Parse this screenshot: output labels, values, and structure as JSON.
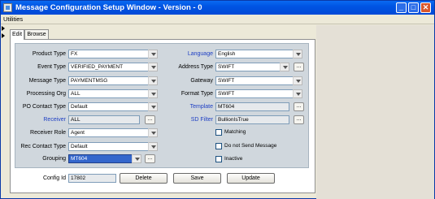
{
  "window": {
    "title": "Message Configuration Setup Window - Version - 0"
  },
  "menubar": {
    "label": "Utilities"
  },
  "tabs": [
    {
      "label": "Edit"
    },
    {
      "label": "Browse"
    }
  ],
  "left_fields": [
    {
      "label": "Product Type",
      "value": "FX"
    },
    {
      "label": "Event Type",
      "value": "VERIFIED_PAYMENT"
    },
    {
      "label": "Message Type",
      "value": "PAYMENTMSG"
    },
    {
      "label": "Processing Org",
      "value": "ALL"
    },
    {
      "label": "PO Contact Type",
      "value": "Default"
    },
    {
      "label": "Receiver",
      "value": "ALL"
    },
    {
      "label": "Receiver Role",
      "value": "Agent"
    },
    {
      "label": "Rec Contact Type",
      "value": "Default"
    },
    {
      "label": "Grouping",
      "value": "MT604"
    }
  ],
  "right_fields": [
    {
      "label": "Language",
      "value": "English"
    },
    {
      "label": "Address Type",
      "value": "SWIFT"
    },
    {
      "label": "Gateway",
      "value": "SWIFT"
    },
    {
      "label": "Format Type",
      "value": "SWIFT"
    },
    {
      "label": "Template",
      "value": "MT604"
    },
    {
      "label": "SD Filter",
      "value": "BullionIsTrue"
    }
  ],
  "checkboxes": [
    {
      "label": "Matching",
      "checked": false
    },
    {
      "label": "Do not Send Message",
      "checked": false
    },
    {
      "label": "Inactive",
      "checked": false
    }
  ],
  "config": {
    "label": "Config Id",
    "value": "17802"
  },
  "buttons": {
    "delete": "Delete",
    "save": "Save",
    "update": "Update",
    "ellipsis": "..."
  },
  "colors": {
    "titlebar": "#0054e3",
    "link_label": "#1e3fc4",
    "group_bg": "#d0d7dd",
    "selected_field": "#3366cc"
  }
}
